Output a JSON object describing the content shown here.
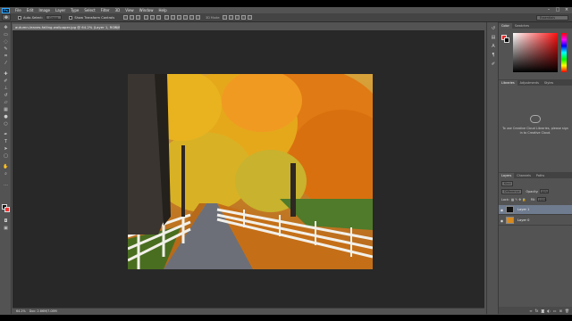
{
  "app": {
    "logo": "Ps",
    "menu": [
      "File",
      "Edit",
      "Image",
      "Layer",
      "Type",
      "Select",
      "Filter",
      "3D",
      "View",
      "Window",
      "Help"
    ],
    "window_controls": [
      "–",
      "□",
      "×"
    ]
  },
  "options_bar": {
    "auto_select_label": "Auto-Select:",
    "auto_select_value": "Group",
    "show_transform_label": "Show Transform Controls",
    "mode_3d_label": "3D Mode:",
    "workspace": "Essentials"
  },
  "document": {
    "tab_title": "autumn-leaves-falling-wallpaper.jpg @ 64.2% (Layer 1, RGB/8*)",
    "close_glyph": "×",
    "zoom": "64.2%",
    "doc_size": "Doc: 2.86M/7.08M"
  },
  "panels": {
    "color_tabs": [
      "Color",
      "Swatches"
    ],
    "library_tabs": [
      "Libraries",
      "Adjustments",
      "Styles"
    ],
    "library_message": "To use Creative Cloud Libraries, please sign in to Creative Cloud.",
    "layers_tabs": [
      "Layers",
      "Channels",
      "Paths"
    ],
    "kind_filter": "Kind",
    "blend_mode": "Difference",
    "opacity_label": "Opacity:",
    "opacity_value": "80%",
    "lock_label": "Lock:",
    "fill_label": "Fill:",
    "fill_value": "100%",
    "layers": [
      {
        "name": "Layer 1",
        "selected": true
      },
      {
        "name": "Layer 0",
        "selected": false
      }
    ]
  },
  "colors": {
    "ui_bg": "#535353",
    "canvas_bg": "#282828",
    "foliage_orange": "#e88a1a",
    "foliage_yellow": "#e3b01b",
    "selection": "#6f7b8f"
  }
}
